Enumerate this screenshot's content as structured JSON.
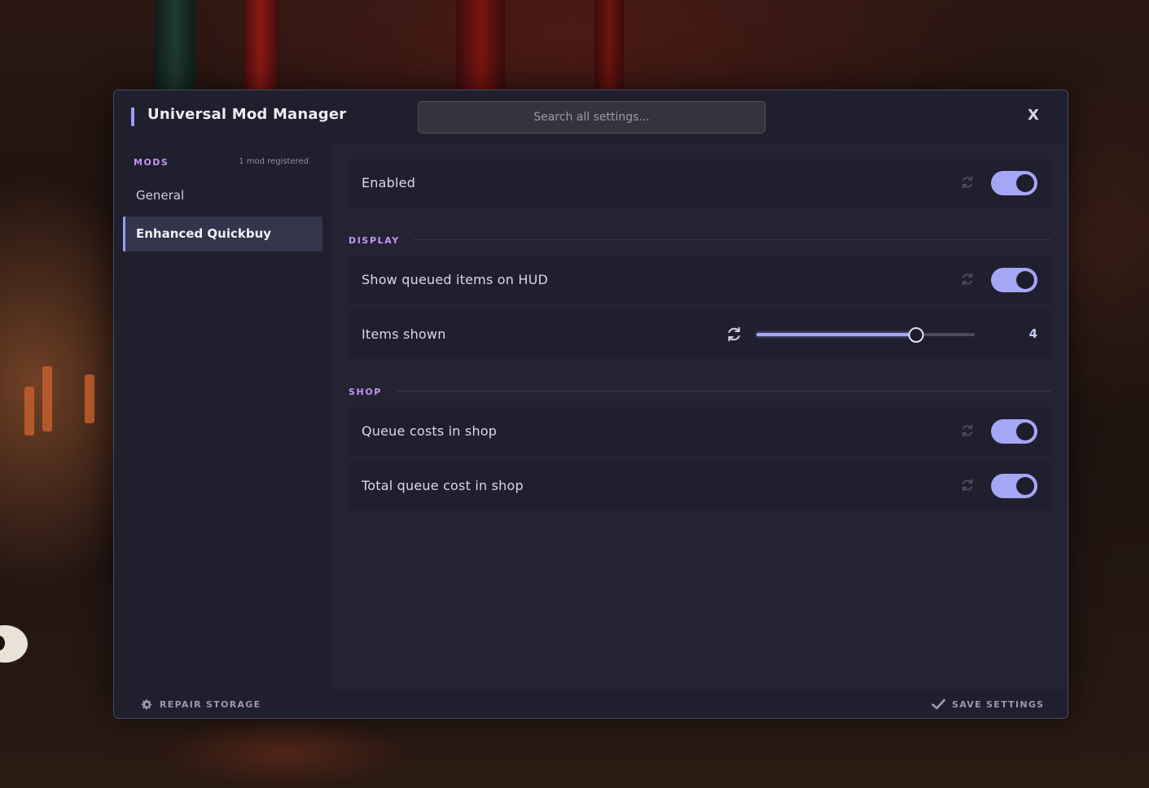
{
  "app": {
    "title": "Universal Mod Manager",
    "close_label": "X"
  },
  "search": {
    "placeholder": "Search all settings..."
  },
  "sidebar": {
    "section_label": "MODS",
    "count_label": "1 mod registered",
    "items": [
      {
        "label": "General",
        "active": false
      },
      {
        "label": "Enhanced Quickbuy",
        "active": true
      }
    ]
  },
  "settings": {
    "enabled": {
      "label": "Enabled",
      "value": true
    },
    "display": {
      "title": "DISPLAY",
      "show_queued": {
        "label": "Show queued items on HUD",
        "value": true
      },
      "items_shown": {
        "label": "Items shown",
        "value": "4",
        "fraction": 0.73
      }
    },
    "shop": {
      "title": "SHOP",
      "queue_costs": {
        "label": "Queue costs in shop",
        "value": true
      },
      "total_queue_cost": {
        "label": "Total queue cost in shop",
        "value": true
      }
    }
  },
  "footer": {
    "repair_label": "REPAIR STORAGE",
    "save_label": "SAVE SETTINGS"
  },
  "colors": {
    "accent": "#a5a6f6",
    "section": "#c596f0",
    "panel": "#1f1f2e",
    "content": "#232334"
  },
  "icons": {
    "reset": "refresh-icon",
    "repair": "gear-icon",
    "save": "checkmark-icon"
  }
}
